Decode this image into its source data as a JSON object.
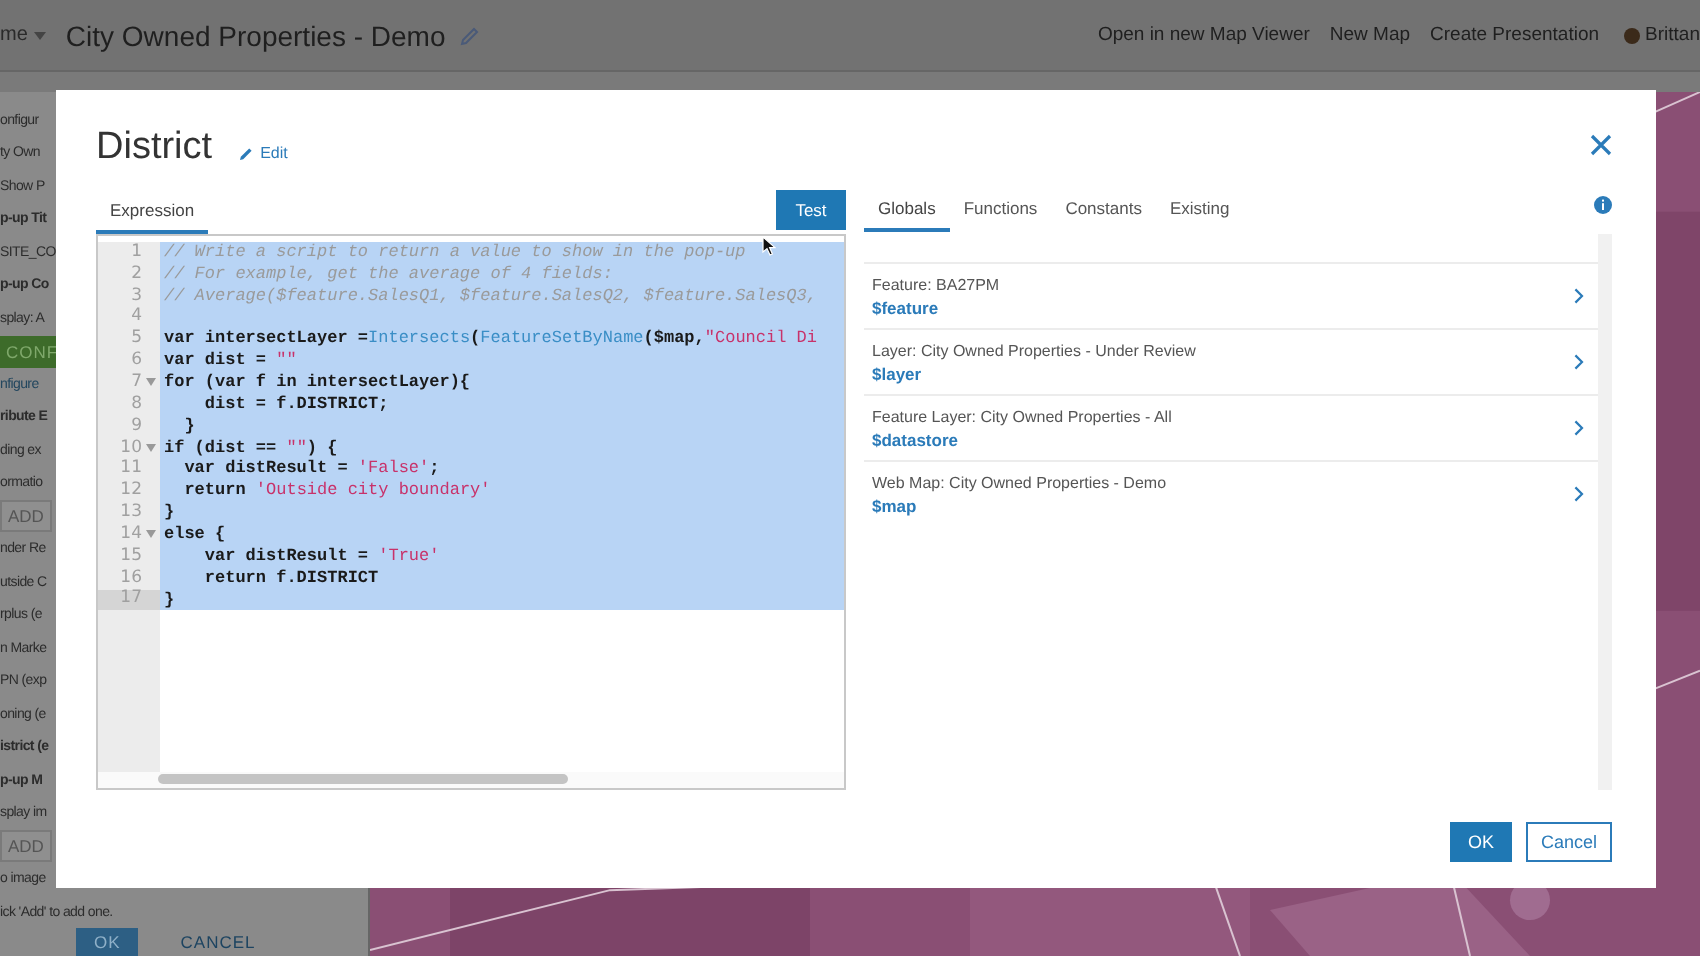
{
  "header": {
    "menu_label": "me",
    "title": "City Owned Properties - Demo",
    "links": [
      "Open in new Map Viewer",
      "New Map",
      "Create Presentation"
    ],
    "user": "Brittan"
  },
  "sidebar": {
    "items": [
      {
        "kind": "text",
        "text": "onfigur"
      },
      {
        "kind": "text",
        "text": "ty Own"
      },
      {
        "kind": "text",
        "text": "Show P"
      },
      {
        "kind": "heading",
        "text": "p-up Tit"
      },
      {
        "kind": "text",
        "text": "SITE_CO"
      },
      {
        "kind": "heading",
        "text": "p-up Co"
      },
      {
        "kind": "text",
        "text": "splay: A"
      },
      {
        "kind": "green",
        "text": "CONF"
      },
      {
        "kind": "link",
        "text": "nfigure"
      },
      {
        "kind": "heading",
        "text": "ribute E"
      },
      {
        "kind": "text",
        "text": "ding ex"
      },
      {
        "kind": "text",
        "text": "ormatio"
      },
      {
        "kind": "button",
        "text": "ADD"
      },
      {
        "kind": "text",
        "text": "nder Re"
      },
      {
        "kind": "text",
        "text": "utside C"
      },
      {
        "kind": "text",
        "text": "rplus (e"
      },
      {
        "kind": "text",
        "text": "n Marke"
      },
      {
        "kind": "text",
        "text": "PN (exp"
      },
      {
        "kind": "text",
        "text": "oning (e"
      },
      {
        "kind": "heading",
        "text": "istrict (e"
      },
      {
        "kind": "heading",
        "text": "p-up M"
      },
      {
        "kind": "text",
        "text": "splay im"
      },
      {
        "kind": "button",
        "text": "ADD"
      },
      {
        "kind": "text",
        "text": "o image"
      },
      {
        "kind": "text",
        "text": "ick 'Add' to add one."
      }
    ],
    "buttons": [
      {
        "label": "OK",
        "primary": true
      },
      {
        "label": "CANCEL",
        "primary": false
      }
    ]
  },
  "dialog": {
    "title": "District",
    "edit_label": "Edit",
    "editor_tabs": [
      {
        "label": "Expression",
        "selected": true
      }
    ],
    "test_button": "Test",
    "code_lines": [
      {
        "number": "1",
        "fold": false,
        "selected": true,
        "active": false,
        "tokens": [
          {
            "kind": "comment",
            "text": "// Write a script to return a value to show in the pop-up"
          }
        ]
      },
      {
        "number": "2",
        "fold": false,
        "selected": true,
        "active": false,
        "tokens": [
          {
            "kind": "comment",
            "text": "// For example, get the average of 4 fields:"
          }
        ]
      },
      {
        "number": "3",
        "fold": false,
        "selected": true,
        "active": false,
        "tokens": [
          {
            "kind": "comment",
            "text": "// Average($feature.SalesQ1, $feature.SalesQ2, $feature.SalesQ3,"
          }
        ]
      },
      {
        "number": "4",
        "fold": false,
        "selected": true,
        "active": false
      },
      {
        "number": "5",
        "fold": false,
        "selected": true,
        "active": false,
        "tokens": [
          {
            "kind": "plain",
            "text": "var intersectLayer ="
          },
          {
            "kind": "function",
            "text": "Intersects"
          },
          {
            "kind": "plain",
            "text": "("
          },
          {
            "kind": "function",
            "text": "FeatureSetByName"
          },
          {
            "kind": "plain",
            "text": "($map,"
          },
          {
            "kind": "string",
            "text": "\"Council Di"
          }
        ]
      },
      {
        "number": "6",
        "fold": false,
        "selected": true,
        "active": false,
        "tokens": [
          {
            "kind": "plain",
            "text": "var dist = "
          },
          {
            "kind": "string",
            "text": "\"\""
          }
        ]
      },
      {
        "number": "7",
        "fold": true,
        "selected": true,
        "active": false,
        "tokens": [
          {
            "kind": "plain",
            "text": "for (var f in intersectLayer){"
          }
        ]
      },
      {
        "number": "8",
        "fold": false,
        "selected": true,
        "active": false,
        "tokens": [
          {
            "kind": "plain",
            "text": "    dist = f.DISTRICT;"
          }
        ]
      },
      {
        "number": "9",
        "fold": false,
        "selected": true,
        "active": false,
        "tokens": [
          {
            "kind": "plain",
            "text": "  }"
          }
        ]
      },
      {
        "number": "10",
        "fold": true,
        "selected": true,
        "active": false,
        "tokens": [
          {
            "kind": "plain",
            "text": "if (dist == "
          },
          {
            "kind": "string",
            "text": "\"\""
          },
          {
            "kind": "plain",
            "text": ") {"
          }
        ]
      },
      {
        "number": "11",
        "fold": false,
        "selected": true,
        "active": false,
        "tokens": [
          {
            "kind": "plain",
            "text": "  var distResult = "
          },
          {
            "kind": "string",
            "text": "'False'"
          },
          {
            "kind": "plain",
            "text": ";"
          }
        ]
      },
      {
        "number": "12",
        "fold": false,
        "selected": true,
        "active": false,
        "tokens": [
          {
            "kind": "plain",
            "text": "  return "
          },
          {
            "kind": "string",
            "text": "'Outside city boundary'"
          }
        ]
      },
      {
        "number": "13",
        "fold": false,
        "selected": true,
        "active": false,
        "tokens": [
          {
            "kind": "plain",
            "text": "}"
          }
        ]
      },
      {
        "number": "14",
        "fold": true,
        "selected": true,
        "active": false,
        "tokens": [
          {
            "kind": "plain",
            "text": "else {"
          }
        ]
      },
      {
        "number": "15",
        "fold": false,
        "selected": true,
        "active": false,
        "tokens": [
          {
            "kind": "plain",
            "text": "    var distResult = "
          },
          {
            "kind": "string",
            "text": "'True'"
          }
        ]
      },
      {
        "number": "16",
        "fold": false,
        "selected": true,
        "active": false,
        "tokens": [
          {
            "kind": "plain",
            "text": "    return f.DISTRICT"
          }
        ]
      },
      {
        "number": "17",
        "fold": false,
        "selected": true,
        "active": true,
        "tokens": [
          {
            "kind": "plain",
            "text": "}"
          }
        ]
      }
    ],
    "side_tabs": [
      {
        "label": "Globals",
        "selected": true
      },
      {
        "label": "Functions",
        "selected": false
      },
      {
        "label": "Constants",
        "selected": false
      },
      {
        "label": "Existing",
        "selected": false
      }
    ],
    "globals": [
      {
        "label": "Feature: BA27PM",
        "variable": "$feature"
      },
      {
        "label": "Layer: City Owned Properties - Under Review",
        "variable": "$layer"
      },
      {
        "label": "Feature Layer: City Owned Properties - All",
        "variable": "$datastore"
      },
      {
        "label": "Web Map: City Owned Properties - Demo",
        "variable": "$map"
      }
    ],
    "buttons": [
      {
        "label": "OK",
        "primary": true
      },
      {
        "label": "Cancel",
        "primary": false
      }
    ]
  }
}
